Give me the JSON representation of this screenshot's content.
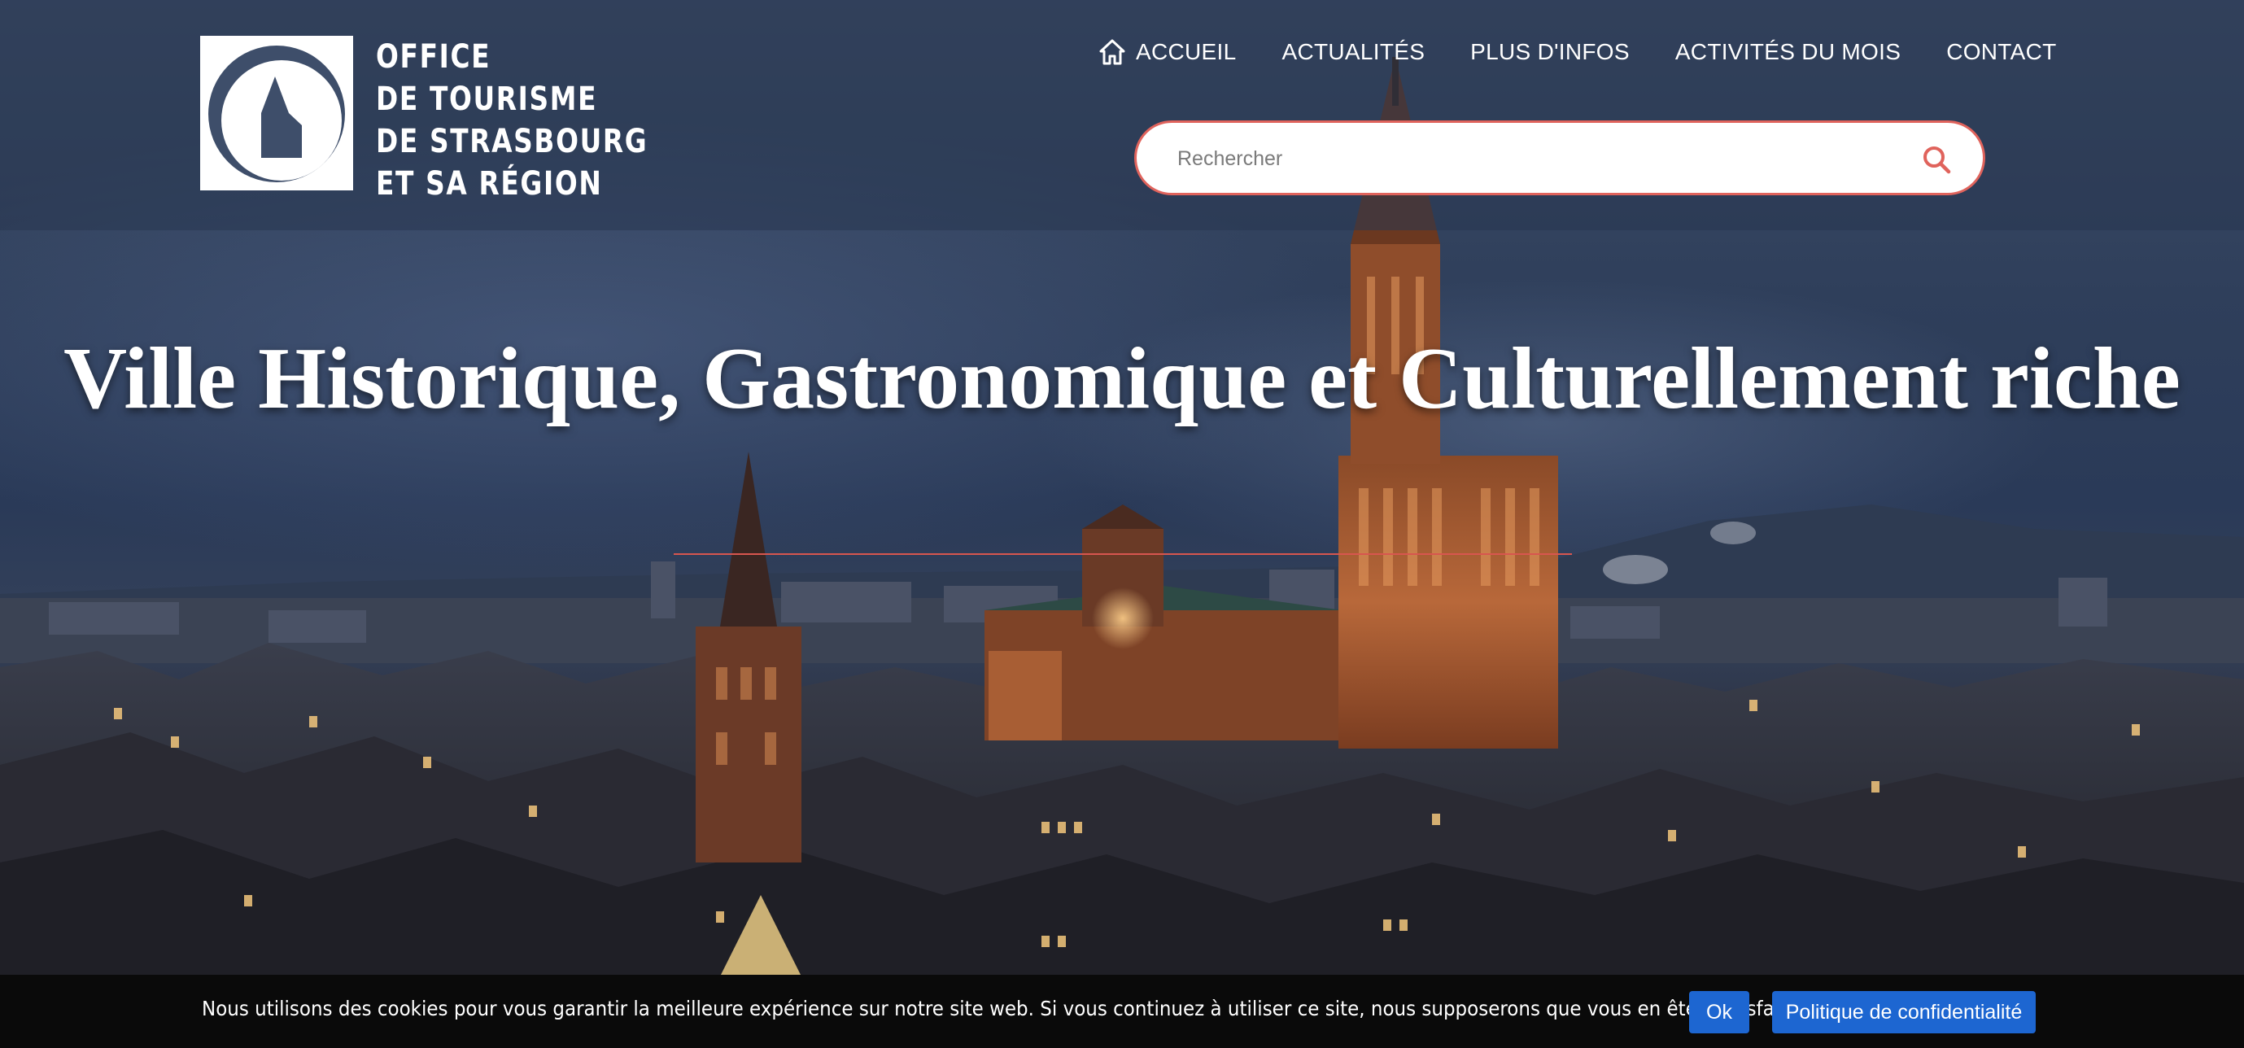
{
  "brand": {
    "lines": [
      "OFFICE",
      "DE TOURISME",
      "DE STRASBOURG",
      "ET SA RÉGION"
    ]
  },
  "nav": {
    "items": [
      {
        "label": "ACCUEIL",
        "icon": "home-icon"
      },
      {
        "label": "ACTUALITÉS"
      },
      {
        "label": "PLUS D'INFOS"
      },
      {
        "label": "ACTIVITÉS DU MOIS"
      },
      {
        "label": "CONTACT"
      }
    ]
  },
  "search": {
    "placeholder": "Rechercher",
    "value": "",
    "icon": "search-icon"
  },
  "hero": {
    "title": "Ville Historique, Gastronomique et Culturellement riche",
    "image": "strasbourg-cathedral-night-skyline"
  },
  "cookie": {
    "message": "Nous utilisons des cookies pour vous garantir la meilleure expérience sur notre site web. Si vous continuez à utiliser ce site, nous supposerons que vous en êtes satisfait.",
    "ok_label": "Ok",
    "privacy_label": "Politique de confidentialité"
  },
  "colors": {
    "accent": "#e0635c",
    "button": "#1d66d1",
    "cookie_bar": "#0a0a0a",
    "header_overlay": "#283750"
  }
}
